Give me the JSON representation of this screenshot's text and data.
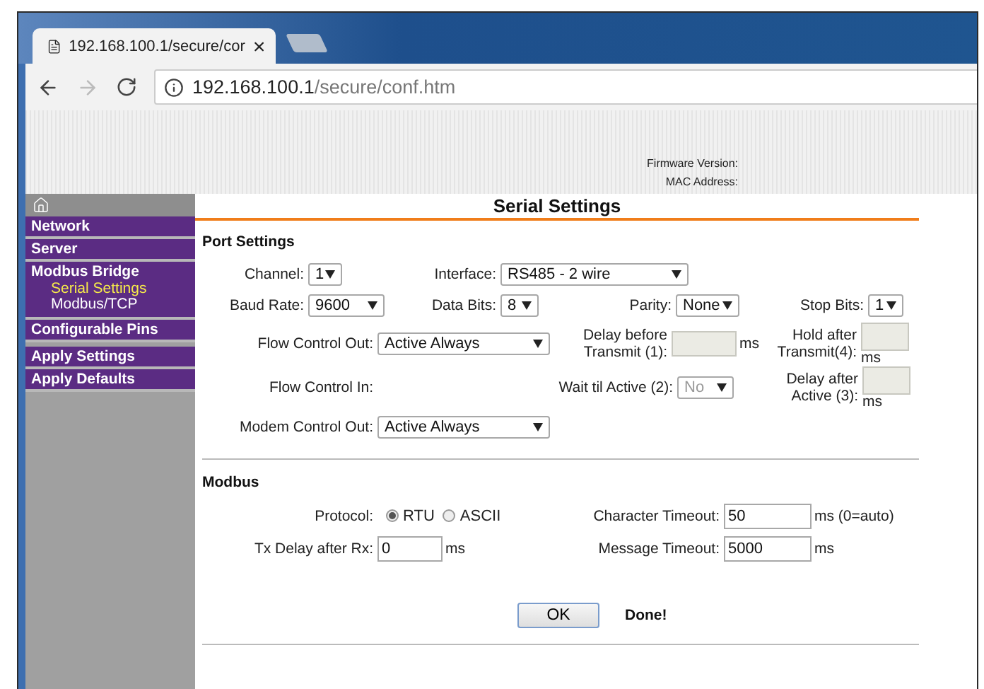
{
  "browser": {
    "tab_title": "192.168.100.1/secure/cor",
    "address_host": "192.168.100.1",
    "address_path": "/secure/conf.htm"
  },
  "header": {
    "fields": [
      {
        "label": "Firmware Version:"
      },
      {
        "label": "MAC Address:"
      }
    ]
  },
  "sidebar": {
    "items": [
      {
        "label": "Network",
        "selected": false
      },
      {
        "label": "Server",
        "selected": false
      },
      {
        "label": "Modbus Bridge",
        "selected": false,
        "children": [
          {
            "label": "Serial Settings",
            "selected": true
          },
          {
            "label": "Modbus/TCP",
            "selected": false
          }
        ]
      },
      {
        "label": "Configurable Pins",
        "selected": false
      },
      {
        "label": "Apply Settings",
        "selected": false
      },
      {
        "label": "Apply Defaults",
        "selected": false
      }
    ]
  },
  "page_title": "Serial Settings",
  "port_settings": {
    "title": "Port Settings",
    "fields": [
      {
        "kind": "select",
        "label": "Channel:",
        "value": "1",
        "disabled": false
      },
      {
        "kind": "select",
        "label": "Interface:",
        "value": "RS485 - 2 wire",
        "disabled": false
      },
      {
        "kind": "select",
        "label": "Baud Rate:",
        "value": "9600",
        "disabled": false
      },
      {
        "kind": "select",
        "label": "Data Bits:",
        "value": "8",
        "disabled": false
      },
      {
        "kind": "select",
        "label": "Parity:",
        "value": "None",
        "disabled": false
      },
      {
        "kind": "select",
        "label": "Stop Bits:",
        "value": "1",
        "disabled": false
      },
      {
        "kind": "select",
        "label": "Flow Control Out:",
        "value": "Active Always",
        "disabled": false
      },
      {
        "kind": "input",
        "label": "Delay before Transmit (1):",
        "disabled": true,
        "unit": "ms"
      },
      {
        "kind": "input",
        "label": "Hold after Transmit(4):",
        "disabled": true,
        "unit": "ms"
      },
      {
        "kind": "label",
        "label": "Flow Control In:"
      },
      {
        "kind": "select",
        "label": "Wait til Active (2):",
        "value": "No",
        "disabled": true
      },
      {
        "kind": "input",
        "label": "Delay after Active (3):",
        "disabled": true,
        "unit": "ms"
      },
      {
        "kind": "select",
        "label": "Modem Control Out:",
        "value": "Active Always",
        "disabled": false
      }
    ]
  },
  "modbus": {
    "title": "Modbus",
    "fields": [
      {
        "kind": "radio",
        "label": "Protocol:",
        "options": [
          {
            "label": "RTU",
            "selected": true
          },
          {
            "label": "ASCII",
            "selected": false
          }
        ]
      },
      {
        "kind": "input",
        "label": "Character Timeout:",
        "value": "50",
        "disabled": false,
        "unit": "ms (0=auto)"
      },
      {
        "kind": "input",
        "label": "Tx Delay after Rx:",
        "value": "0",
        "disabled": false,
        "unit": "ms"
      },
      {
        "kind": "input",
        "label": "Message Timeout:",
        "value": "5000",
        "disabled": false,
        "unit": "ms"
      }
    ]
  },
  "ok_button": "OK",
  "status": "Done!"
}
